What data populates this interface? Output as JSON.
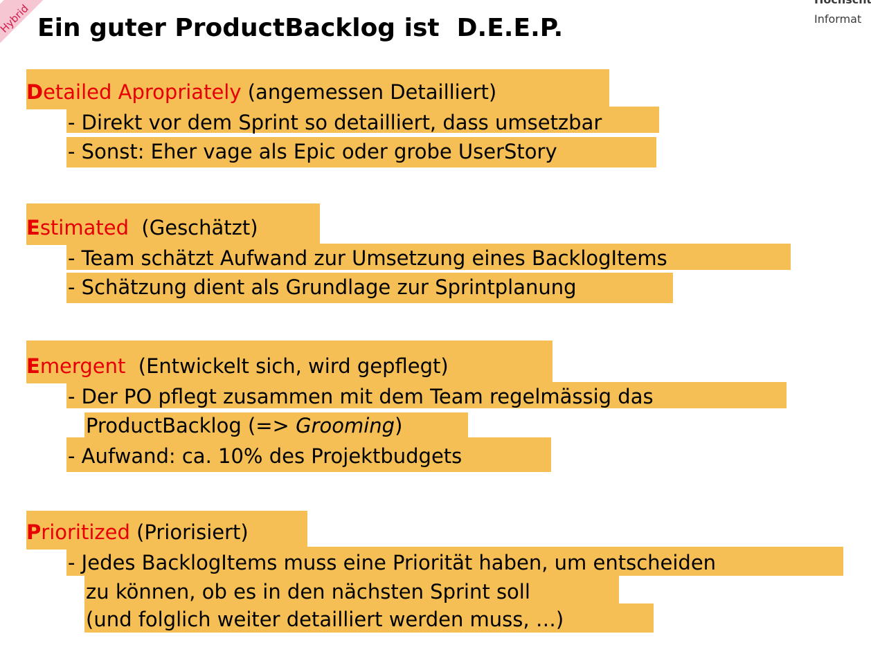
{
  "corner_label": "Hybrid",
  "logo": {
    "line1": "Hochschu",
    "line2": "Informat"
  },
  "title": "Ein guter ProductBacklog ist  D.E.E.P.",
  "sections": [
    {
      "initial": "D",
      "term_rest": "etailed Apropriately",
      "gloss": " (angemessen Detailliert)",
      "bullets": [
        "- Direkt vor dem Sprint so detailliert, dass umsetzbar",
        "- Sonst: Eher vage als Epic oder grobe UserStory"
      ]
    },
    {
      "initial": "E",
      "term_rest": "stimated",
      "gloss": "  (Geschätzt)",
      "bullets": [
        "- Team schätzt Aufwand zur Umsetzung eines BacklogItems",
        "- Schätzung dient als Grundlage zur Sprintplanung"
      ]
    },
    {
      "initial": "E",
      "term_rest": "mergent",
      "gloss": "  (Entwickelt sich, wird gepflegt)",
      "bullets": [
        "- Der PO pflegt zusammen mit dem Team regelmässig das",
        "- Aufwand: ca. 10% des Projektbudgets"
      ],
      "continuation_prefix": "ProductBacklog (=> ",
      "continuation_italic": "Grooming",
      "continuation_suffix": ")"
    },
    {
      "initial": "P",
      "term_rest": "rioritized",
      "gloss": " (Priorisiert)",
      "bullets": [
        "- Jedes BacklogItems muss eine Priorität haben, um entscheiden"
      ],
      "continuation_lines": [
        "zu können, ob es in den nächsten Sprint soll",
        "(und folglich weiter detailliert werden muss, …)"
      ]
    }
  ],
  "colors": {
    "highlight": "#f5bf55",
    "accent": "#e60000"
  }
}
